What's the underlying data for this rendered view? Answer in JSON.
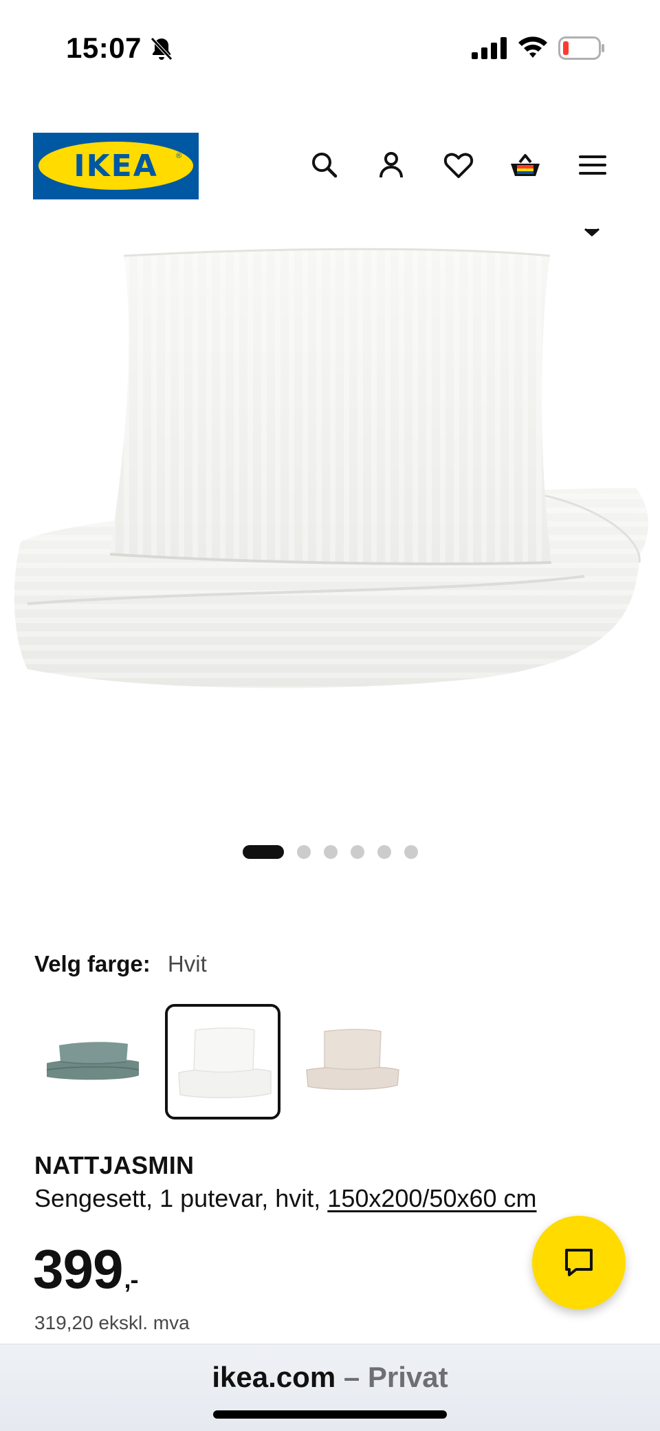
{
  "status_bar": {
    "time": "15:07",
    "icons": [
      "bell-slash-icon",
      "signal-icon",
      "wifi-icon",
      "battery-low-icon"
    ]
  },
  "header": {
    "logo_text": "IKEA",
    "logo_reg": "®",
    "icons": [
      "search-icon",
      "account-icon",
      "heart-icon",
      "basket-icon",
      "menu-icon"
    ],
    "colors": {
      "brand_blue": "#0058a3",
      "brand_yellow": "#ffdb00"
    }
  },
  "gallery": {
    "image_count": 6,
    "active_index": 0
  },
  "color_selector": {
    "label": "Velg farge:",
    "selected_value": "Hvit",
    "swatches": [
      "grey-green",
      "white",
      "beige"
    ],
    "selected_index": 1
  },
  "product": {
    "name": "NATTJASMIN",
    "description_prefix": "Sengesett, 1 putevar, hvit,",
    "size_link": "150x200/50x60 cm",
    "price_main": "399",
    "price_suffix": ",-",
    "price_excl_vat": "319,20 ekskl. mva"
  },
  "chat": {
    "icon": "chat-icon",
    "color": "#ffdb00"
  },
  "browser": {
    "domain": "ikea.com",
    "separator": "–",
    "mode": "Privat"
  }
}
